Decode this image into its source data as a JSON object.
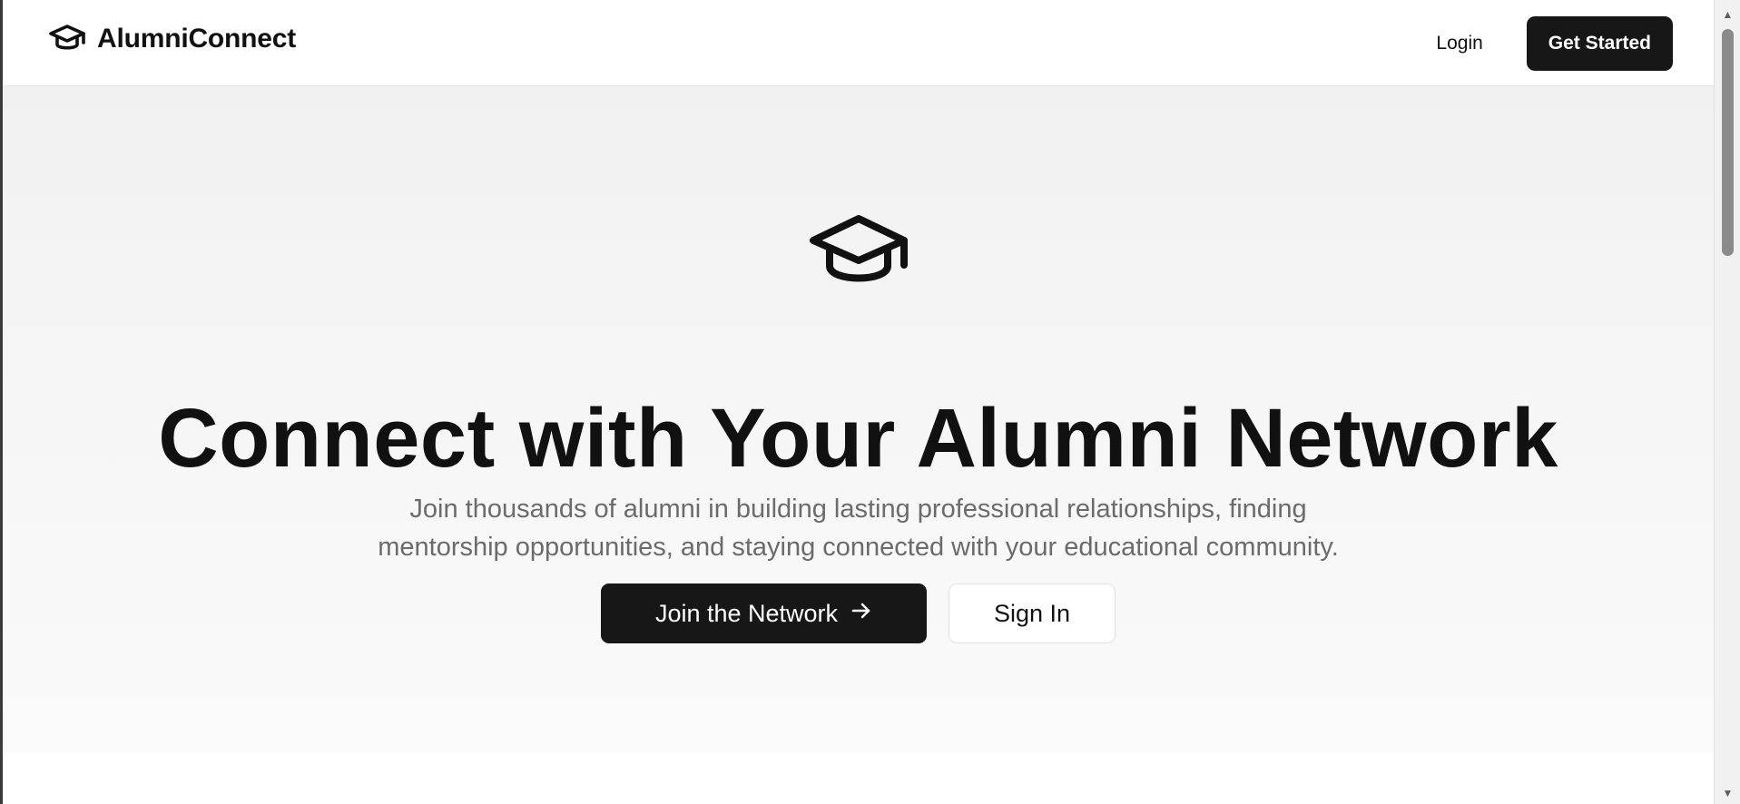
{
  "brand": {
    "name": "AlumniConnect",
    "icon": "graduation-cap-icon"
  },
  "nav": {
    "login_label": "Login",
    "get_started_label": "Get Started"
  },
  "hero": {
    "icon": "graduation-cap-icon",
    "title": "Connect with Your Alumni Network",
    "subtitle_line1": "Join thousands of alumni in building lasting professional relationships, finding",
    "subtitle_line2": "mentorship opportunities, and staying connected with your educational community.",
    "primary_cta": "Join the Network",
    "primary_cta_icon": "arrow-right-icon",
    "secondary_cta": "Sign In"
  },
  "colors": {
    "primary": "#171717",
    "text": "#111111",
    "muted": "#6b6b6b",
    "hero_bg": "#f3f3f3"
  }
}
